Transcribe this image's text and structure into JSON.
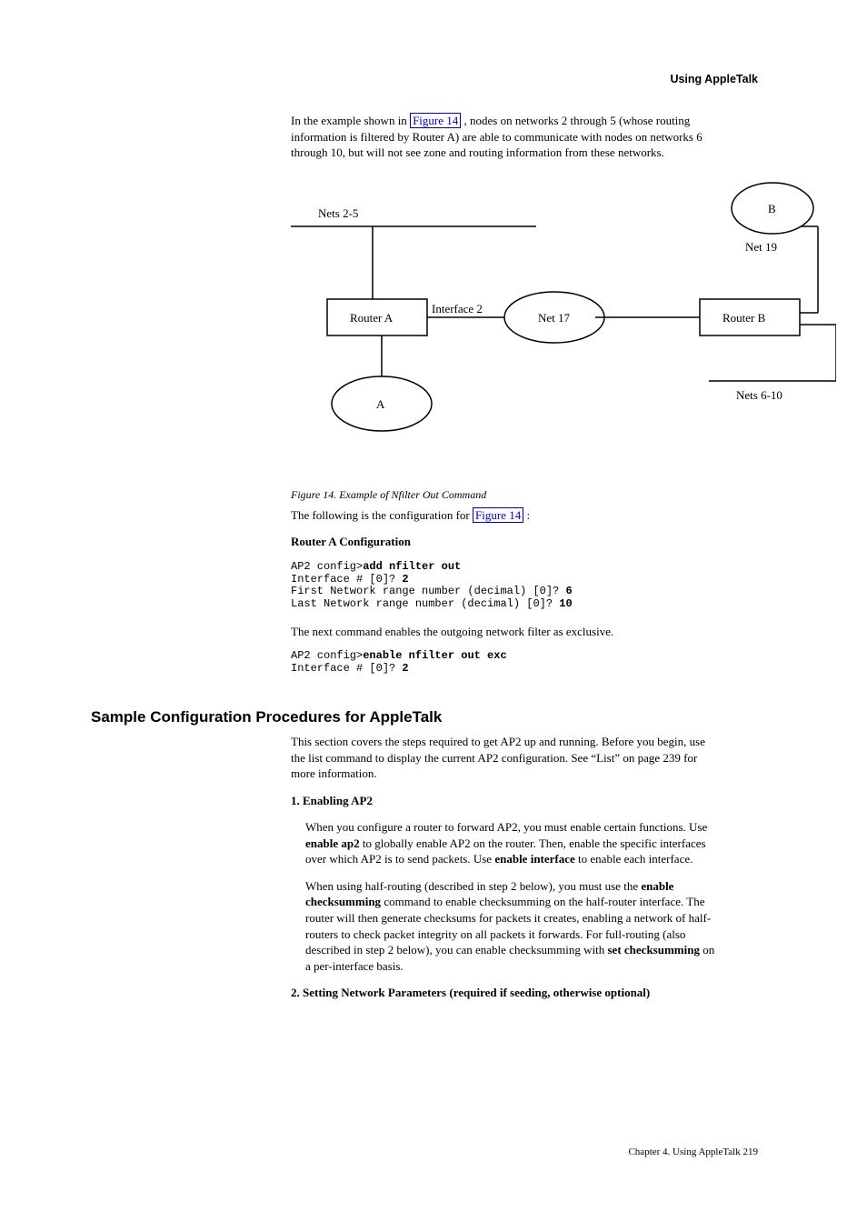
{
  "running_head": "Using AppleTalk",
  "intro_para": {
    "prefix": "In the example shown in ",
    "figref": "Figure 14",
    "suffix": ", nodes on networks 2 through 5 (whose routing information is filtered by Router A) are able to communicate with nodes on networks 6 through 10, but will not see zone and routing information from these networks."
  },
  "figure": {
    "label": "Figure 14. Example of Nfilter Out Command",
    "nets_2_5": "Nets 2-5",
    "router_a": "Router A",
    "interface_2": "Interface 2",
    "net_17": "Net 17",
    "router_b": "Router B",
    "net_19": "Net 19",
    "nets_6_10": "Nets 6-10",
    "cloud_a": "A",
    "cloud_b": "B"
  },
  "config_lead": {
    "prefix": "The following is the configuration for ",
    "figref": "Figure 14",
    "suffix": ":"
  },
  "section_config_title": "Router A Configuration",
  "block1": {
    "l1a": "AP2 config>",
    "l1b": "add nfilter out",
    "l2a": "Interface # [0]? ",
    "l2b": "2",
    "l3a": "First Network range number (decimal) [0]? ",
    "l3b": "6",
    "l4a": "Last Network range number (decimal) [0]? ",
    "l4b": "10"
  },
  "enable_lead": "The next command enables the outgoing network filter as exclusive.",
  "block2": {
    "l1a": "AP2 config>",
    "l1b": "enable nfilter out exc",
    "l2a": "Interface # [0]? ",
    "l2b": "2"
  },
  "sample_section_title": "Sample Configuration Procedures for AppleTalk",
  "sample_p1": "This section covers the steps required to get AP2 up and running. Before you begin, use the list command to display the current AP2 configuration. See “List” on page 239 for more information.",
  "sample_step1_title": "1. Enabling AP2",
  "sample_step1_p1": {
    "prefix": "When you configure a router to forward AP2, you must enable certain functions. Use ",
    "cmd1": "enable ap2",
    "mid": " to globally enable AP2 on the router. Then, enable the specific interfaces over which AP2 is to send packets. Use ",
    "cmd2": "enable interface",
    "suffix": " to enable each interface."
  },
  "sample_step1_p2": {
    "prefix": "When using half-routing (described in step 2 below), you must use the ",
    "cmd1": "enable checksumming",
    "mid": " command to enable checksumming on the half-router interface. The router will then generate checksums for packets it creates, enabling a network of half-routers to check packet integrity on all packets it forwards. For full-routing (also described in step 2 below), you can enable checksumming with ",
    "cmd2": "set checksumming",
    "suffix": " on a per-interface basis."
  },
  "sample_step2_title": "2. Setting Network Parameters (required if seeding, otherwise optional)",
  "footer": {
    "text": "Chapter 4. Using AppleTalk  219"
  }
}
